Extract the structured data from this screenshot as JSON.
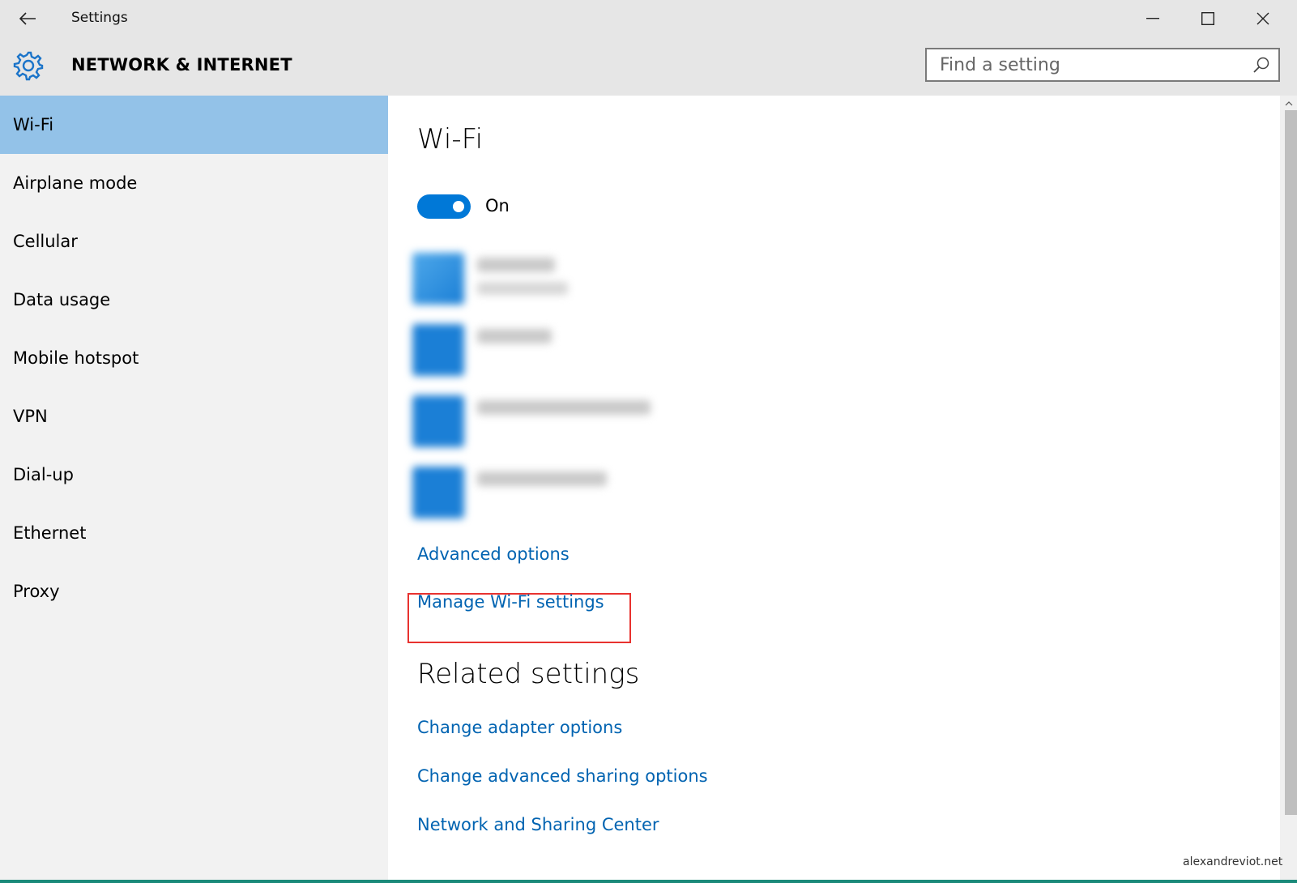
{
  "window": {
    "title": "Settings",
    "icons": {
      "back": "back-arrow-icon",
      "minimize": "minimize-icon",
      "maximize": "maximize-icon",
      "close": "close-icon"
    }
  },
  "header": {
    "title": "NETWORK & INTERNET",
    "icon": "gear-icon",
    "search_placeholder": "Find a setting"
  },
  "sidebar": {
    "items": [
      {
        "label": "Wi-Fi",
        "active": true
      },
      {
        "label": "Airplane mode"
      },
      {
        "label": "Cellular"
      },
      {
        "label": "Data usage"
      },
      {
        "label": "Mobile hotspot"
      },
      {
        "label": "VPN"
      },
      {
        "label": "Dial-up"
      },
      {
        "label": "Ethernet"
      },
      {
        "label": "Proxy"
      }
    ]
  },
  "main": {
    "title": "Wi-Fi",
    "toggle_label": "On",
    "toggle_on": true,
    "networks_blurred": 4,
    "links": {
      "advanced_options": "Advanced options",
      "manage_wifi": "Manage Wi-Fi settings"
    },
    "related": {
      "title": "Related settings",
      "links": [
        "Change adapter options",
        "Change advanced sharing options",
        "Network and Sharing Center"
      ]
    }
  },
  "colors": {
    "accent": "#0078d7",
    "link": "#0063b1",
    "active_nav": "#93c2e8",
    "highlight_box": "#e8322f"
  },
  "watermark": "alexandreviot.net"
}
